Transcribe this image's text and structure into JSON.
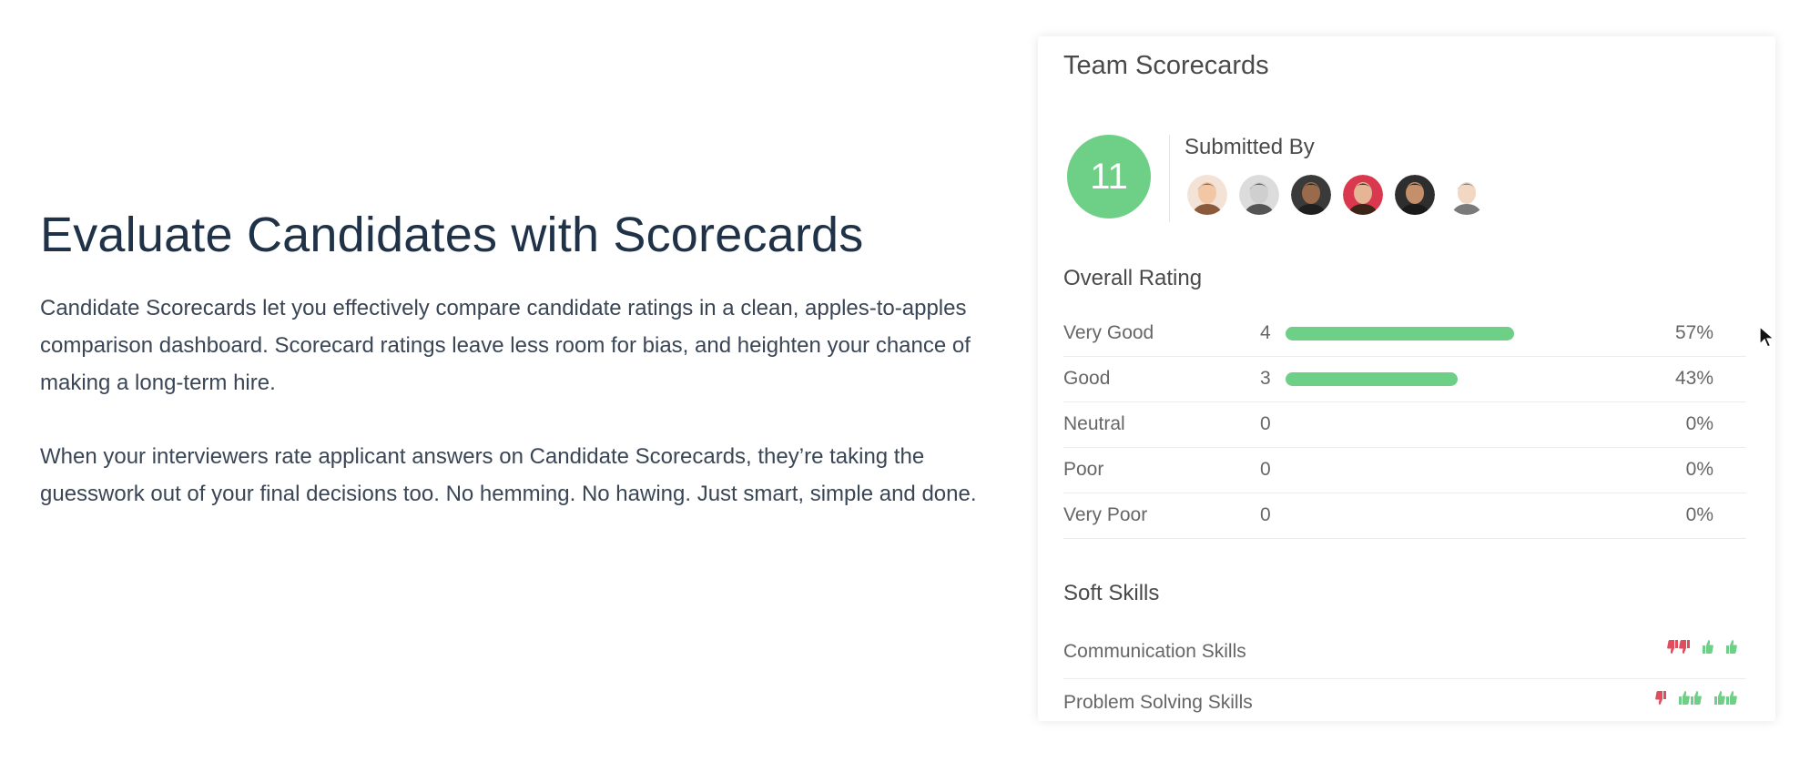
{
  "content": {
    "headline": "Evaluate Candidates with Scorecards",
    "paragraph_1": "Candidate Scorecards let you effectively compare candidate ratings in a clean, apples-to-apples comparison dashboard. Scorecard ratings leave less room for bias, and heighten your chance of making a long-term hire.",
    "paragraph_2": "When your interviewers rate applicant answers on Candidate Scorecards, they’re taking the guesswork out of your final decisions too. No hemming. No hawing. Just smart, simple and done."
  },
  "scorecard": {
    "title": "Team Scorecards",
    "total_count": "11",
    "submitted_by_label": "Submitted By",
    "avatars": [
      {
        "icon": "avatar-woman-icon",
        "bg": "#f3e2d6",
        "hair": "#8a5a3b",
        "skin": "#f1c7a6"
      },
      {
        "icon": "avatar-man-gray-icon",
        "bg": "#dcdcdc",
        "hair": "#555555",
        "skin": "#cfcfcf"
      },
      {
        "icon": "avatar-man-dark-icon",
        "bg": "#3a3a3a",
        "hair": "#1f1f1f",
        "skin": "#9a6b4a"
      },
      {
        "icon": "avatar-man-red-icon",
        "bg": "#d9384e",
        "hair": "#3b2418",
        "skin": "#e5b595"
      },
      {
        "icon": "avatar-man-beard-icon",
        "bg": "#2e2e2e",
        "hair": "#1a1a1a",
        "skin": "#c4906c"
      },
      {
        "icon": "avatar-man-cartoon-icon",
        "bg": "#ffffff",
        "hair": "#7a7a7a",
        "skin": "#f2d7c2"
      }
    ],
    "overall_rating_label": "Overall Rating",
    "ratings": [
      {
        "label": "Very Good",
        "count": "4",
        "percent": "57%",
        "fill": 0.57
      },
      {
        "label": "Good",
        "count": "3",
        "percent": "43%",
        "fill": 0.43
      },
      {
        "label": "Neutral",
        "count": "0",
        "percent": "0%",
        "fill": 0
      },
      {
        "label": "Poor",
        "count": "0",
        "percent": "0%",
        "fill": 0
      },
      {
        "label": "Very Poor",
        "count": "0",
        "percent": "0%",
        "fill": 0
      }
    ],
    "soft_skills_label": "Soft Skills",
    "skills": [
      {
        "label": "Communication Skills",
        "icons": [
          {
            "type": "thumbs-down",
            "n": 2,
            "color": "#e24d5e"
          },
          {
            "type": "thumbs-up",
            "n": 1,
            "color": "#6ecf86"
          },
          {
            "type": "thumbs-up",
            "n": 1,
            "color": "#6ecf86"
          }
        ]
      },
      {
        "label": "Problem Solving Skills",
        "icons": [
          {
            "type": "thumbs-down",
            "n": 1,
            "color": "#e24d5e"
          },
          {
            "type": "thumbs-up",
            "n": 2,
            "color": "#6ecf86"
          },
          {
            "type": "thumbs-up",
            "n": 2,
            "color": "#6ecf86"
          }
        ]
      }
    ]
  },
  "colors": {
    "accent_green": "#6ecf86",
    "negative_red": "#e24d5e",
    "headline": "#1f3247"
  },
  "cursor": {
    "icon": "mouse-pointer-icon"
  }
}
